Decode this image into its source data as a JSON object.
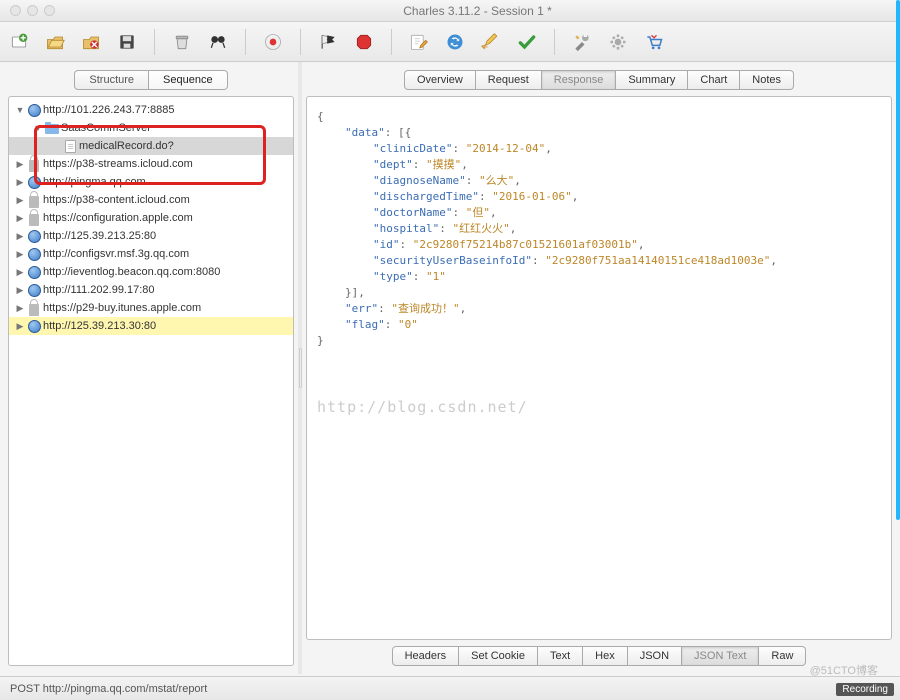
{
  "window": {
    "title": "Charles 3.11.2 - Session 1 *"
  },
  "view_tabs": {
    "structure": "Structure",
    "sequence": "Sequence",
    "active": "sequence"
  },
  "tree": {
    "items": [
      {
        "expanded": true,
        "icon": "globe",
        "indent": 0,
        "label": "http://101.226.243.77:8885",
        "sel": false
      },
      {
        "expanded": true,
        "icon": "folder",
        "indent": 1,
        "label": "SaasCommServer",
        "sel": false
      },
      {
        "expanded": null,
        "icon": "file",
        "indent": 2,
        "label": "medicalRecord.do?",
        "sel": true
      },
      {
        "expanded": false,
        "icon": "lock",
        "indent": 0,
        "label": "https://p38-streams.icloud.com",
        "sel": false
      },
      {
        "expanded": false,
        "icon": "globe",
        "indent": 0,
        "label": "http://pingma.qq.com",
        "sel": false
      },
      {
        "expanded": false,
        "icon": "lock",
        "indent": 0,
        "label": "https://p38-content.icloud.com",
        "sel": false
      },
      {
        "expanded": false,
        "icon": "lock",
        "indent": 0,
        "label": "https://configuration.apple.com",
        "sel": false
      },
      {
        "expanded": false,
        "icon": "globe",
        "indent": 0,
        "label": "http://125.39.213.25:80",
        "sel": false
      },
      {
        "expanded": false,
        "icon": "globe",
        "indent": 0,
        "label": "http://configsvr.msf.3g.qq.com",
        "sel": false
      },
      {
        "expanded": false,
        "icon": "globe",
        "indent": 0,
        "label": "http://ieventlog.beacon.qq.com:8080",
        "sel": false
      },
      {
        "expanded": false,
        "icon": "globe",
        "indent": 0,
        "label": "http://111.202.99.17:80",
        "sel": false
      },
      {
        "expanded": false,
        "icon": "lock",
        "indent": 0,
        "label": "https://p29-buy.itunes.apple.com",
        "sel": false
      },
      {
        "expanded": false,
        "icon": "globe",
        "indent": 0,
        "label": "http://125.39.213.30:80",
        "sel": false,
        "hl": true
      }
    ]
  },
  "detail_tabs_top": {
    "items": [
      "Overview",
      "Request",
      "Response",
      "Summary",
      "Chart",
      "Notes"
    ],
    "active": 2
  },
  "detail_tabs_bot": {
    "items": [
      "Headers",
      "Set Cookie",
      "Text",
      "Hex",
      "JSON",
      "JSON Text",
      "Raw"
    ],
    "active": 5
  },
  "response_json": {
    "data": [
      {
        "k": "clinicDate",
        "v": "2014-12-04"
      },
      {
        "k": "dept",
        "v": "摸摸"
      },
      {
        "k": "diagnoseName",
        "v": "么大"
      },
      {
        "k": "dischargedTime",
        "v": "2016-01-06"
      },
      {
        "k": "doctorName",
        "v": "但"
      },
      {
        "k": "hospital",
        "v": "红红火火"
      },
      {
        "k": "id",
        "v": "2c9280f75214b87c01521601af03001b"
      },
      {
        "k": "securityUserBaseinfoId",
        "v": "2c9280f751aa14140151ce418ad1003e"
      },
      {
        "k": "type",
        "v": "1"
      }
    ],
    "err": "查询成功！",
    "flag": "0"
  },
  "watermark": "http://blog.csdn.net/",
  "statusbar": {
    "text": "POST http://pingma.qq.com/mstat/report",
    "recording": "Recording"
  },
  "attribution": "@51CTO博客",
  "toolbar_icons": [
    "new",
    "open",
    "close-session",
    "save",
    "trash",
    "find",
    "record",
    "flag-start",
    "stop",
    "compose",
    "refresh",
    "edit",
    "validate",
    "tools",
    "settings",
    "cart"
  ]
}
